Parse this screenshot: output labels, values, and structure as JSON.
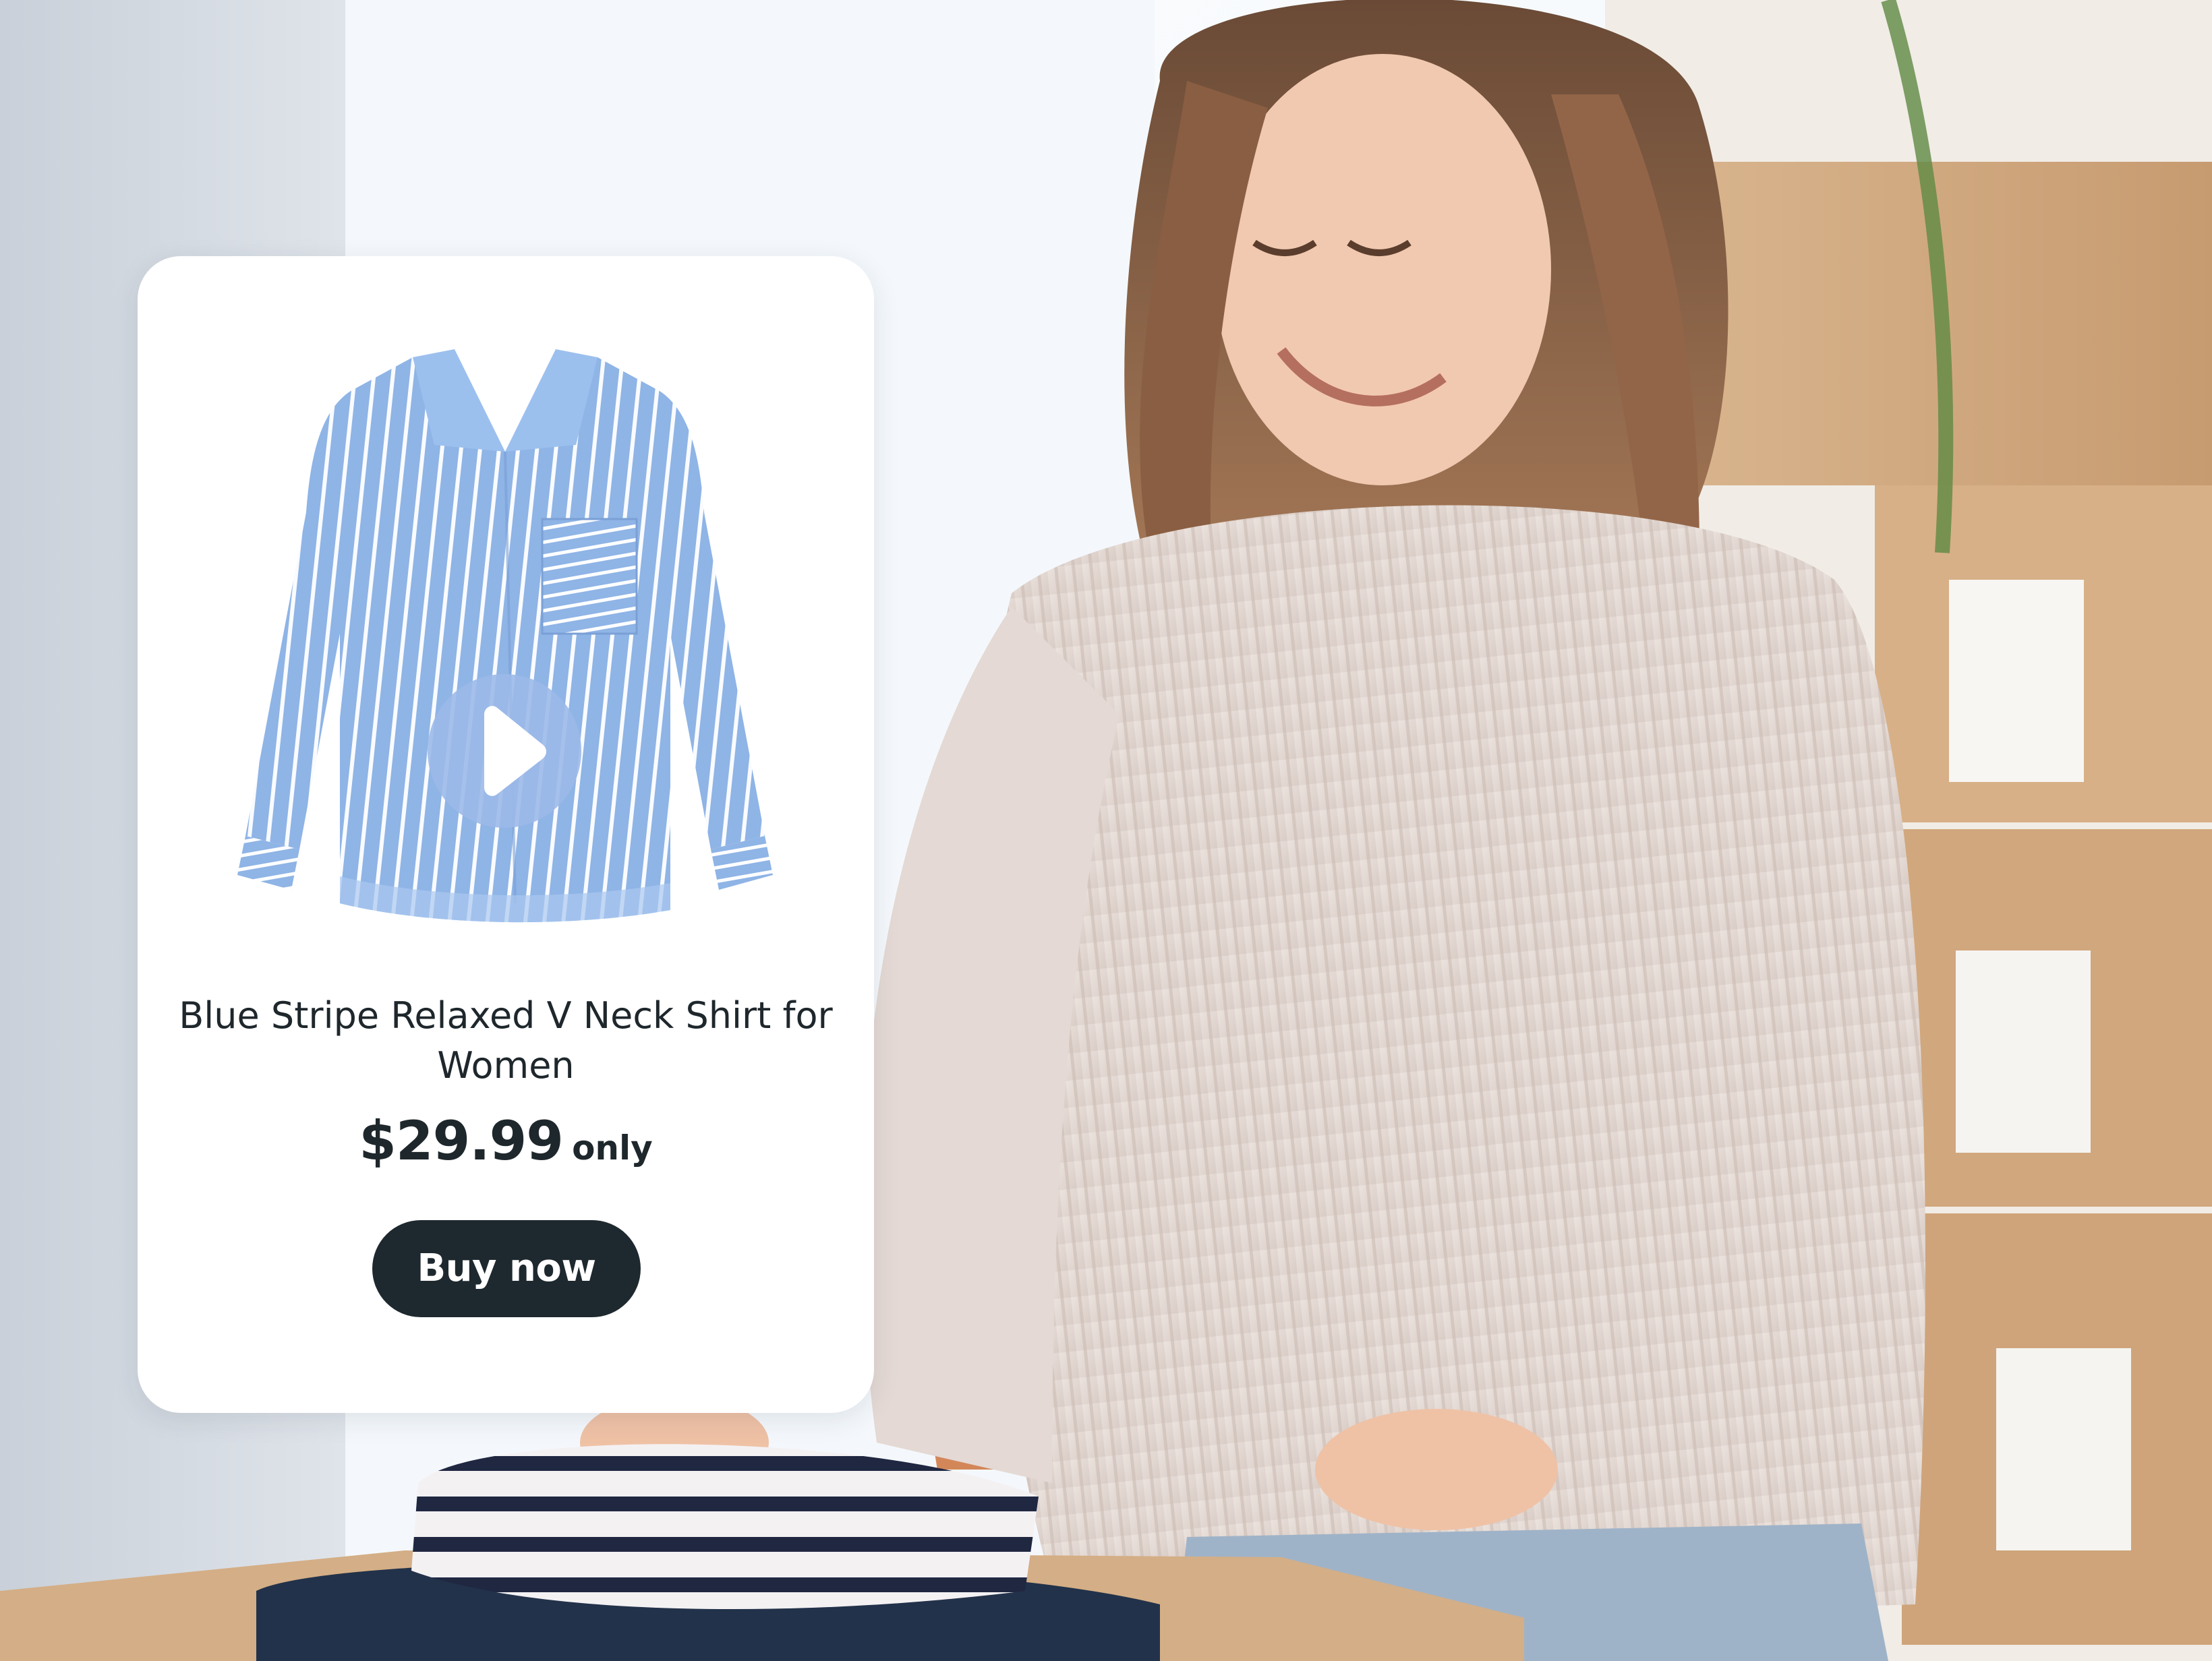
{
  "product_card": {
    "title": "Blue Stripe Relaxed V Neck Shirt for Women",
    "price": "$29.99",
    "price_suffix": "only",
    "buy_button_label": "Buy now",
    "media_icon": "play-icon"
  },
  "colors": {
    "card_background": "#ffffff",
    "button_background": "#1e292f",
    "button_text": "#ffffff",
    "text_primary": "#1e272c",
    "shirt_blue": "#8fb4e6",
    "play_button": "#9bb9e8"
  }
}
